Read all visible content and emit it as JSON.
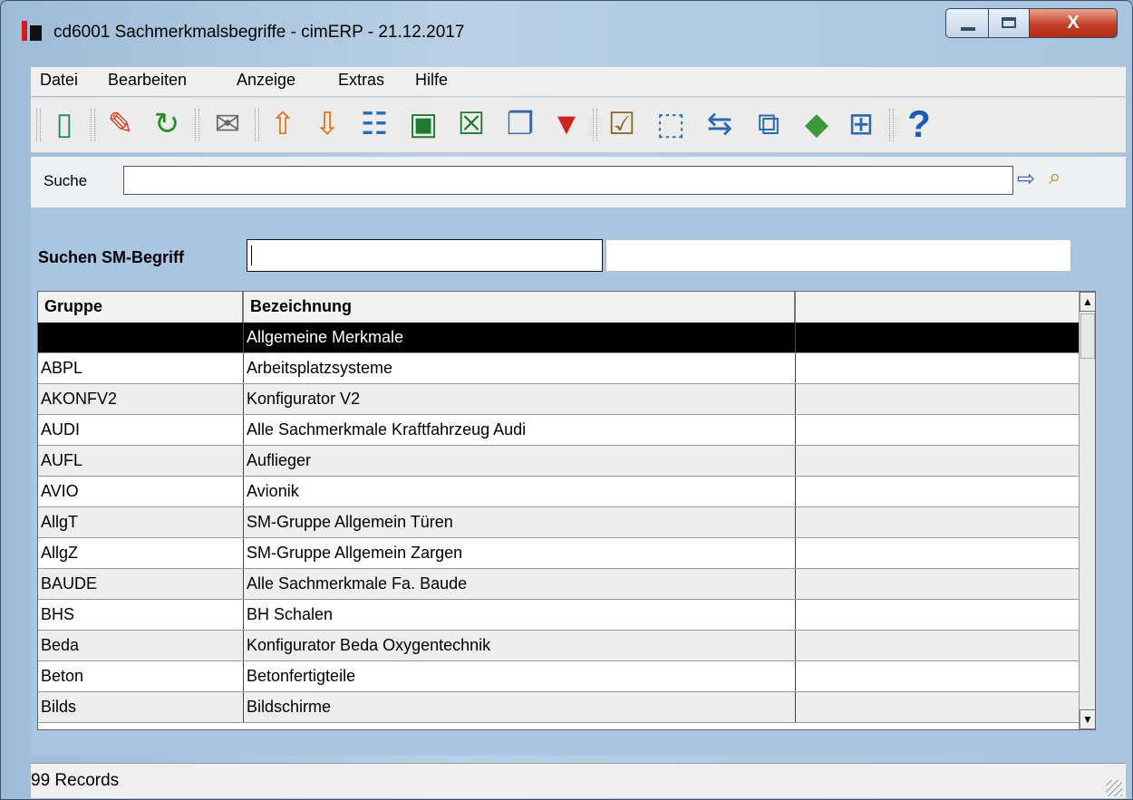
{
  "window": {
    "title": "cd6001 Sachmerkmalsbegriffe - cimERP - 21.12.2017",
    "close_glyph": "X"
  },
  "menu": [
    "Datei",
    "Bearbeiten",
    "Anzeige",
    "Extras",
    "Hilfe"
  ],
  "toolbar": {
    "icons": [
      "exit-icon",
      "edit-icon",
      "refresh-icon",
      "mail-icon",
      "sort-ascending-icon",
      "sort-descending-icon",
      "number-list-icon",
      "export-icon",
      "excel-icon",
      "copy-icon",
      "filter-icon",
      "properties-icon",
      "select-area-icon",
      "transfer-icon",
      "windows-icon",
      "book-icon",
      "grid-icon",
      "help-icon"
    ],
    "help_glyph": "?"
  },
  "search": {
    "label": "Suche",
    "value": ""
  },
  "filter": {
    "label": "Suchen SM-Begriff",
    "value": ""
  },
  "table": {
    "columns": [
      "Gruppe",
      "Bezeichnung",
      ""
    ],
    "rows": [
      [
        "",
        "Allgemeine Merkmale",
        ""
      ],
      [
        "ABPL",
        "Arbeitsplatzsysteme",
        ""
      ],
      [
        "AKONFV2",
        "Konfigurator V2",
        ""
      ],
      [
        "AUDI",
        "Alle Sachmerkmale Kraftfahrzeug Audi",
        ""
      ],
      [
        "AUFL",
        "Auflieger",
        ""
      ],
      [
        "AVIO",
        "Avionik",
        ""
      ],
      [
        "AllgT",
        "SM-Gruppe Allgemein Türen",
        ""
      ],
      [
        "AllgZ",
        "SM-Gruppe Allgemein Zargen",
        ""
      ],
      [
        "BAUDE",
        "Alle Sachmerkmale Fa. Baude",
        ""
      ],
      [
        "BHS",
        "BH Schalen",
        ""
      ],
      [
        "Beda",
        "Konfigurator Beda Oxygentechnik",
        ""
      ],
      [
        "Beton",
        "Betonfertigteile",
        ""
      ],
      [
        "Bilds",
        "Bildschirme",
        ""
      ]
    ],
    "selected_row": 0
  },
  "status": {
    "text": "99 Records"
  }
}
